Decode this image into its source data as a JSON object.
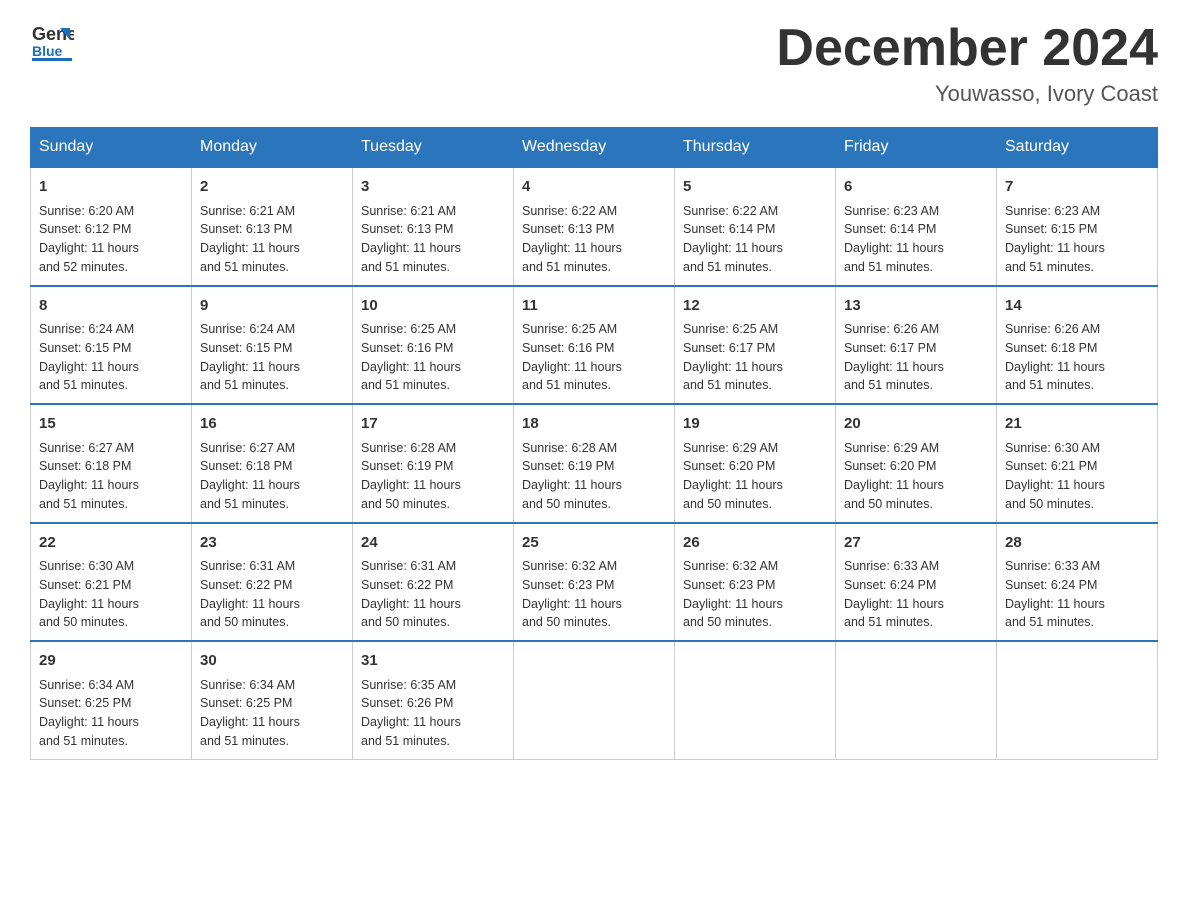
{
  "header": {
    "logo_text_general": "General",
    "logo_text_blue": "Blue",
    "month_title": "December 2024",
    "location": "Youwasso, Ivory Coast"
  },
  "days_of_week": [
    "Sunday",
    "Monday",
    "Tuesday",
    "Wednesday",
    "Thursday",
    "Friday",
    "Saturday"
  ],
  "weeks": [
    [
      {
        "day": "1",
        "sunrise": "6:20 AM",
        "sunset": "6:12 PM",
        "daylight": "11 hours and 52 minutes."
      },
      {
        "day": "2",
        "sunrise": "6:21 AM",
        "sunset": "6:13 PM",
        "daylight": "11 hours and 51 minutes."
      },
      {
        "day": "3",
        "sunrise": "6:21 AM",
        "sunset": "6:13 PM",
        "daylight": "11 hours and 51 minutes."
      },
      {
        "day": "4",
        "sunrise": "6:22 AM",
        "sunset": "6:13 PM",
        "daylight": "11 hours and 51 minutes."
      },
      {
        "day": "5",
        "sunrise": "6:22 AM",
        "sunset": "6:14 PM",
        "daylight": "11 hours and 51 minutes."
      },
      {
        "day": "6",
        "sunrise": "6:23 AM",
        "sunset": "6:14 PM",
        "daylight": "11 hours and 51 minutes."
      },
      {
        "day": "7",
        "sunrise": "6:23 AM",
        "sunset": "6:15 PM",
        "daylight": "11 hours and 51 minutes."
      }
    ],
    [
      {
        "day": "8",
        "sunrise": "6:24 AM",
        "sunset": "6:15 PM",
        "daylight": "11 hours and 51 minutes."
      },
      {
        "day": "9",
        "sunrise": "6:24 AM",
        "sunset": "6:15 PM",
        "daylight": "11 hours and 51 minutes."
      },
      {
        "day": "10",
        "sunrise": "6:25 AM",
        "sunset": "6:16 PM",
        "daylight": "11 hours and 51 minutes."
      },
      {
        "day": "11",
        "sunrise": "6:25 AM",
        "sunset": "6:16 PM",
        "daylight": "11 hours and 51 minutes."
      },
      {
        "day": "12",
        "sunrise": "6:25 AM",
        "sunset": "6:17 PM",
        "daylight": "11 hours and 51 minutes."
      },
      {
        "day": "13",
        "sunrise": "6:26 AM",
        "sunset": "6:17 PM",
        "daylight": "11 hours and 51 minutes."
      },
      {
        "day": "14",
        "sunrise": "6:26 AM",
        "sunset": "6:18 PM",
        "daylight": "11 hours and 51 minutes."
      }
    ],
    [
      {
        "day": "15",
        "sunrise": "6:27 AM",
        "sunset": "6:18 PM",
        "daylight": "11 hours and 51 minutes."
      },
      {
        "day": "16",
        "sunrise": "6:27 AM",
        "sunset": "6:18 PM",
        "daylight": "11 hours and 51 minutes."
      },
      {
        "day": "17",
        "sunrise": "6:28 AM",
        "sunset": "6:19 PM",
        "daylight": "11 hours and 50 minutes."
      },
      {
        "day": "18",
        "sunrise": "6:28 AM",
        "sunset": "6:19 PM",
        "daylight": "11 hours and 50 minutes."
      },
      {
        "day": "19",
        "sunrise": "6:29 AM",
        "sunset": "6:20 PM",
        "daylight": "11 hours and 50 minutes."
      },
      {
        "day": "20",
        "sunrise": "6:29 AM",
        "sunset": "6:20 PM",
        "daylight": "11 hours and 50 minutes."
      },
      {
        "day": "21",
        "sunrise": "6:30 AM",
        "sunset": "6:21 PM",
        "daylight": "11 hours and 50 minutes."
      }
    ],
    [
      {
        "day": "22",
        "sunrise": "6:30 AM",
        "sunset": "6:21 PM",
        "daylight": "11 hours and 50 minutes."
      },
      {
        "day": "23",
        "sunrise": "6:31 AM",
        "sunset": "6:22 PM",
        "daylight": "11 hours and 50 minutes."
      },
      {
        "day": "24",
        "sunrise": "6:31 AM",
        "sunset": "6:22 PM",
        "daylight": "11 hours and 50 minutes."
      },
      {
        "day": "25",
        "sunrise": "6:32 AM",
        "sunset": "6:23 PM",
        "daylight": "11 hours and 50 minutes."
      },
      {
        "day": "26",
        "sunrise": "6:32 AM",
        "sunset": "6:23 PM",
        "daylight": "11 hours and 50 minutes."
      },
      {
        "day": "27",
        "sunrise": "6:33 AM",
        "sunset": "6:24 PM",
        "daylight": "11 hours and 51 minutes."
      },
      {
        "day": "28",
        "sunrise": "6:33 AM",
        "sunset": "6:24 PM",
        "daylight": "11 hours and 51 minutes."
      }
    ],
    [
      {
        "day": "29",
        "sunrise": "6:34 AM",
        "sunset": "6:25 PM",
        "daylight": "11 hours and 51 minutes."
      },
      {
        "day": "30",
        "sunrise": "6:34 AM",
        "sunset": "6:25 PM",
        "daylight": "11 hours and 51 minutes."
      },
      {
        "day": "31",
        "sunrise": "6:35 AM",
        "sunset": "6:26 PM",
        "daylight": "11 hours and 51 minutes."
      },
      null,
      null,
      null,
      null
    ]
  ],
  "labels": {
    "sunrise": "Sunrise:",
    "sunset": "Sunset:",
    "daylight": "Daylight:"
  }
}
